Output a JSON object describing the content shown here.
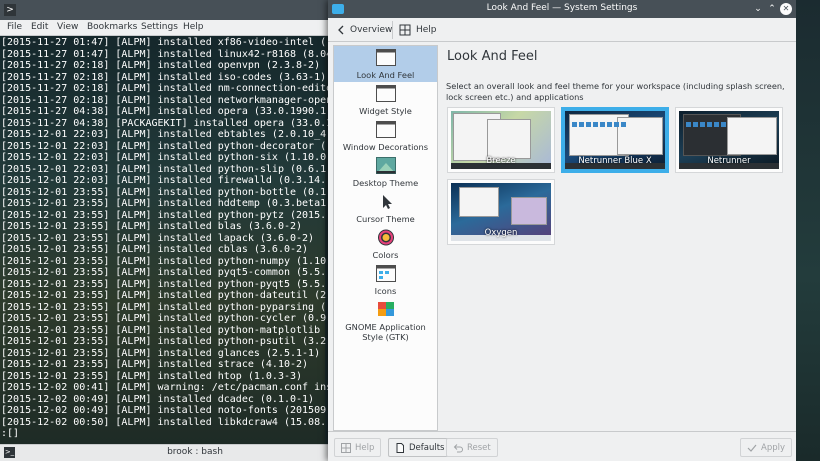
{
  "terminal": {
    "menu": [
      "File",
      "Edit",
      "View",
      "Bookmarks",
      "Settings",
      "Help"
    ],
    "lines": [
      "[2015-11-27 01:47] [ALPM] installed xf86-video-intel (",
      "[2015-11-27 01:47] [ALPM] installed linux42-r8168 (8.04",
      "[2015-11-27 02:18] [ALPM] installed openvpn (2.3.8-2)",
      "[2015-11-27 02:18] [ALPM] installed iso-codes (3.63-1)",
      "[2015-11-27 02:18] [ALPM] installed nm-connection-edito",
      "[2015-11-27 02:18] [ALPM] installed networkmanager-open",
      "[2015-11-27 04:38] [ALPM] installed opera (33.0.1990.1",
      "[2015-11-27 04:38] [PACKAGEKIT] installed opera (33.0.1",
      "[2015-12-01 22:03] [ALPM] installed ebtables (2.0.10_4",
      "[2015-12-01 22:03] [ALPM] installed python-decorator (",
      "[2015-12-01 22:03] [ALPM] installed python-six (1.10.0",
      "[2015-12-01 22:03] [ALPM] installed python-slip (0.6.1",
      "[2015-12-01 22:03] [ALPM] installed firewalld (0.3.14.",
      "[2015-12-01 23:55] [ALPM] installed python-bottle (0.1",
      "[2015-12-01 23:55] [ALPM] installed hddtemp (0.3.beta1",
      "[2015-12-01 23:55] [ALPM] installed python-pytz (2015.",
      "[2015-12-01 23:55] [ALPM] installed blas (3.6.0-2)",
      "[2015-12-01 23:55] [ALPM] installed lapack (3.6.0-2)",
      "[2015-12-01 23:55] [ALPM] installed cblas (3.6.0-2)",
      "[2015-12-01 23:55] [ALPM] installed python-numpy (1.10",
      "[2015-12-01 23:55] [ALPM] installed pyqt5-common (5.5.",
      "[2015-12-01 23:55] [ALPM] installed python-pyqt5 (5.5.",
      "[2015-12-01 23:55] [ALPM] installed python-dateutil (2",
      "[2015-12-01 23:55] [ALPM] installed python-pyparsing (",
      "[2015-12-01 23:55] [ALPM] installed python-cycler (0.9",
      "[2015-12-01 23:55] [ALPM] installed python-matplotlib",
      "[2015-12-01 23:55] [ALPM] installed python-psutil (3.2",
      "[2015-12-01 23:55] [ALPM] installed glances (2.5.1-1)",
      "[2015-12-01 23:55] [ALPM] installed strace (4.10-2)",
      "[2015-12-01 23:55] [ALPM] installed htop (1.0.3-3)",
      "[2015-12-02 00:41] [ALPM] warning: /etc/pacman.conf ins",
      "[2015-12-02 00:49] [ALPM] installed dcadec (0.1.0-1)",
      "[2015-12-02 00:49] [ALPM] installed noto-fonts (201509",
      "[2015-12-02 00:50] [ALPM] installed libkdcraw4 (15.08.",
      ":[]"
    ],
    "tab_title": "brook : bash"
  },
  "window": {
    "title": "Look And Feel  — System Settings"
  },
  "toolbar": {
    "overview_label": "Overview",
    "help_label": "Help"
  },
  "sidebar": {
    "items": [
      {
        "label": "Look And Feel",
        "icon": "look-and-feel-icon",
        "selected": true
      },
      {
        "label": "Widget Style",
        "icon": "widget-style-icon"
      },
      {
        "label": "Window Decorations",
        "icon": "window-decorations-icon"
      },
      {
        "label": "Desktop Theme",
        "icon": "desktop-theme-icon"
      },
      {
        "label": "Cursor Theme",
        "icon": "cursor-icon"
      },
      {
        "label": "Colors",
        "icon": "colors-icon"
      },
      {
        "label": "Icons",
        "icon": "icons-icon"
      },
      {
        "label": "GNOME Application Style (GTK)",
        "icon": "gtk-icon"
      }
    ]
  },
  "content": {
    "title": "Look And Feel",
    "description": "Select an overall look and feel theme for your workspace (including splash screen, lock screen etc.) and applications",
    "themes": [
      {
        "name": "Breeze",
        "selected": false
      },
      {
        "name": "Netrunner Blue X",
        "selected": true
      },
      {
        "name": "Netrunner",
        "selected": false
      },
      {
        "name": "Oxygen",
        "selected": false
      }
    ]
  },
  "footer": {
    "help_label": "Help",
    "defaults_label": "Defaults",
    "reset_label": "Reset",
    "apply_label": "Apply"
  },
  "colors": {
    "accent": "#3daee9",
    "selection": "#b2cde9",
    "titlebar": "#475057"
  }
}
